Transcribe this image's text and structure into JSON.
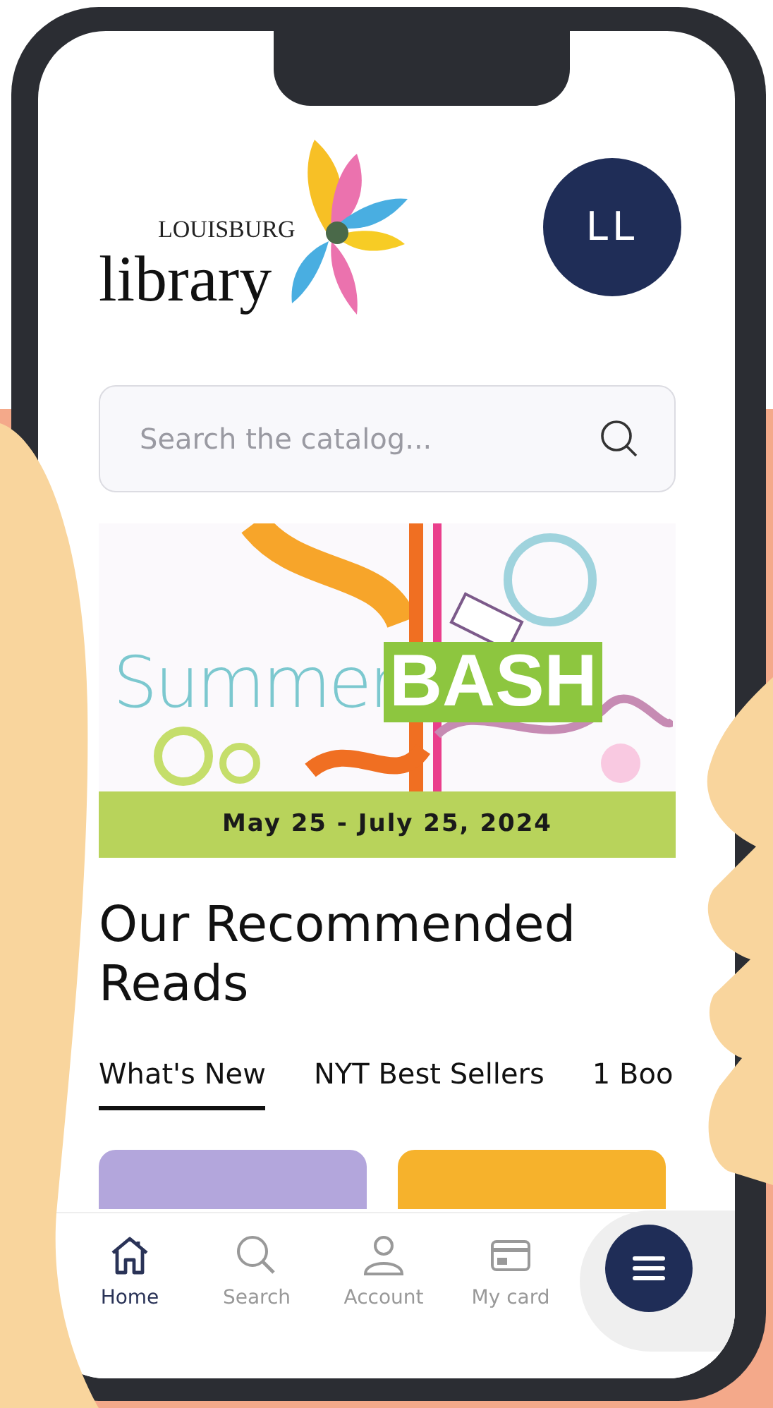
{
  "header": {
    "logo_small": "LOUISBURG",
    "logo_large": "library",
    "avatar": "LL"
  },
  "search": {
    "placeholder": "Search the catalog..."
  },
  "banner": {
    "kind": "picture",
    "title_light": "Summer",
    "title_bold": "BASH",
    "dates": "May 25 - July 25, 2024"
  },
  "section": {
    "title": "Our Recommended Reads"
  },
  "tabs": [
    {
      "label": "What's New",
      "selected": true
    },
    {
      "label": "NYT Best Sellers",
      "selected": false
    },
    {
      "label": "1 Boo",
      "selected": false
    }
  ],
  "books": [
    {
      "color": "#b3a6dc"
    },
    {
      "color": "#f6b22c"
    }
  ],
  "nav": [
    {
      "kind": "home",
      "label": "Home",
      "selected": true
    },
    {
      "kind": "search",
      "label": "Search",
      "selected": false
    },
    {
      "kind": "account",
      "label": "Account",
      "selected": false
    },
    {
      "kind": "card",
      "label": "My card",
      "selected": false
    }
  ]
}
